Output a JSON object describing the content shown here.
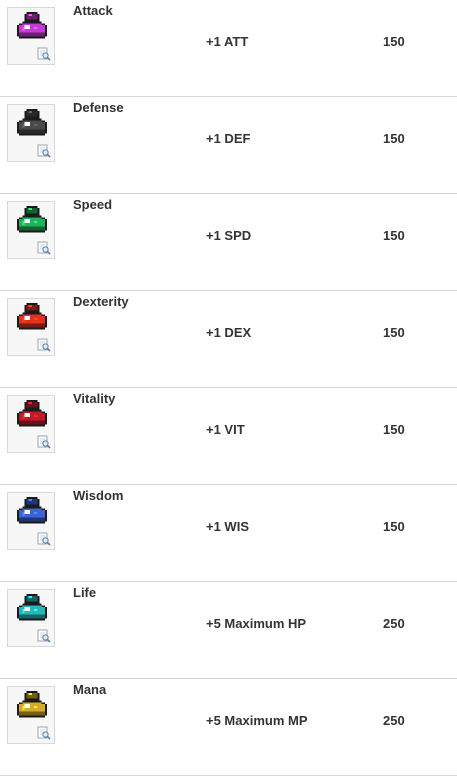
{
  "items": [
    {
      "name": "Attack",
      "effect": "+1 ATT",
      "price": "150",
      "color": "#c43bd1",
      "icon": "attack-potion-icon"
    },
    {
      "name": "Defense",
      "effect": "+1 DEF",
      "price": "150",
      "color": "#4a4a4a",
      "icon": "defense-potion-icon"
    },
    {
      "name": "Speed",
      "effect": "+1 SPD",
      "price": "150",
      "color": "#22b35a",
      "icon": "speed-potion-icon"
    },
    {
      "name": "Dexterity",
      "effect": "+1 DEX",
      "price": "150",
      "color": "#e0321d",
      "icon": "dexterity-potion-icon"
    },
    {
      "name": "Vitality",
      "effect": "+1 VIT",
      "price": "150",
      "color": "#c21b26",
      "icon": "vitality-potion-icon"
    },
    {
      "name": "Wisdom",
      "effect": "+1 WIS",
      "price": "150",
      "color": "#3b63d4",
      "icon": "wisdom-potion-icon"
    },
    {
      "name": "Life",
      "effect": "+5 Maximum HP",
      "price": "250",
      "color": "#27b7b7",
      "icon": "life-potion-icon"
    },
    {
      "name": "Mana",
      "effect": "+5 Maximum MP",
      "price": "250",
      "color": "#d4ab2a",
      "icon": "mana-potion-icon"
    }
  ]
}
